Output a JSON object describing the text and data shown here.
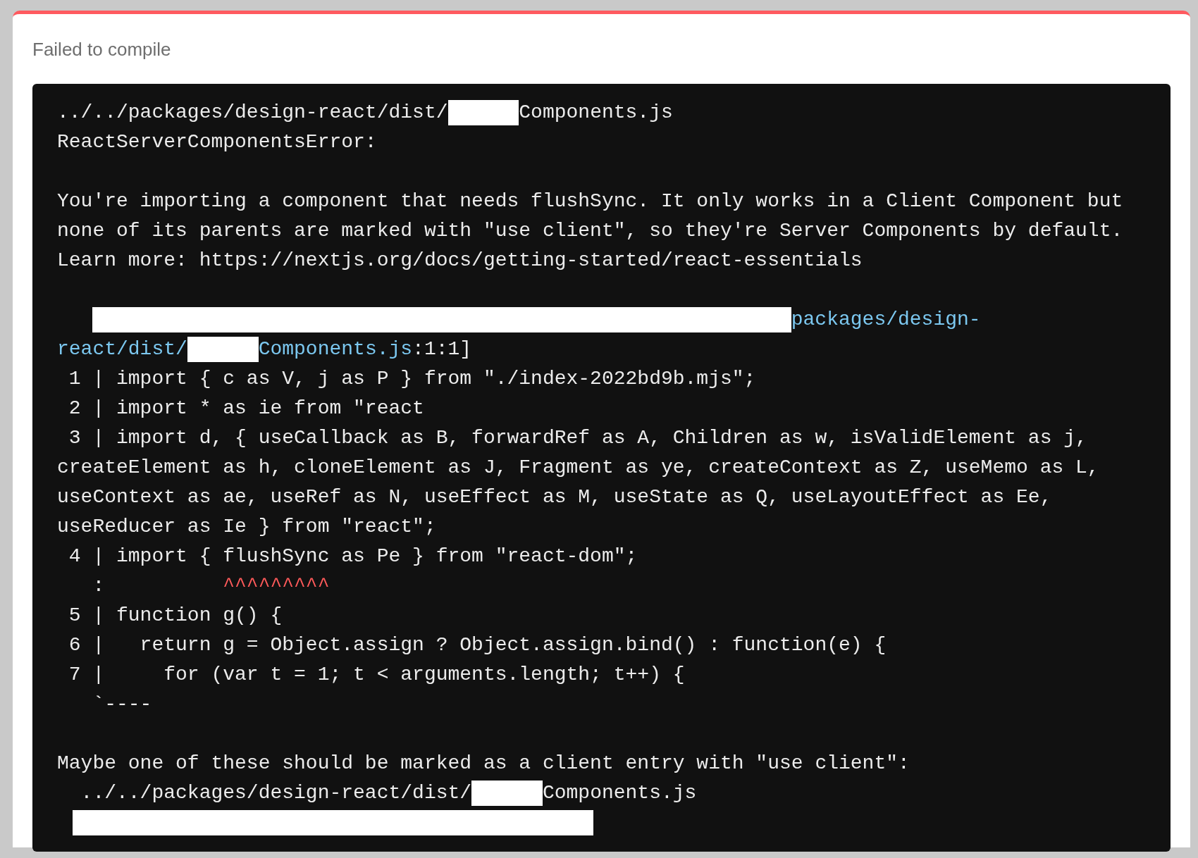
{
  "title": "Failed to compile",
  "lines": [
    {
      "kind": "code",
      "segments": [
        {
          "kind": "text",
          "text": "../../packages/design-react/dist/"
        },
        {
          "kind": "redacted_short"
        },
        {
          "kind": "text",
          "text": "Components.js"
        }
      ]
    },
    {
      "kind": "code",
      "segments": [
        {
          "kind": "text",
          "text": "ReactServerComponentsError:"
        }
      ]
    },
    {
      "kind": "blank"
    },
    {
      "kind": "code",
      "segments": [
        {
          "kind": "text",
          "text": "You're importing a component that needs flushSync. It only works in a Client Component but"
        }
      ]
    },
    {
      "kind": "code",
      "segments": [
        {
          "kind": "text",
          "text": "none of its parents are marked with \"use client\", so they're Server Components by default."
        }
      ]
    },
    {
      "kind": "code",
      "segments": [
        {
          "kind": "text",
          "text": "Learn more: https://nextjs.org/docs/getting-started/react-essentials"
        }
      ]
    },
    {
      "kind": "blank"
    },
    {
      "kind": "code",
      "segments": [
        {
          "kind": "redacted_wide"
        },
        {
          "kind": "link",
          "text": "packages/design-"
        }
      ]
    },
    {
      "kind": "code",
      "segments": [
        {
          "kind": "link",
          "text": "react/dist/"
        },
        {
          "kind": "redacted_short"
        },
        {
          "kind": "link",
          "text": "Components.js"
        },
        {
          "kind": "text",
          "text": ":1:1]"
        }
      ]
    },
    {
      "kind": "code",
      "segments": [
        {
          "kind": "text",
          "text": " 1 | import { c as V, j as P } from \"./index-2022bd9b.mjs\";"
        }
      ]
    },
    {
      "kind": "code",
      "segments": [
        {
          "kind": "text",
          "text": " 2 | import * as ie from \"react"
        }
      ]
    },
    {
      "kind": "code",
      "segments": [
        {
          "kind": "text",
          "text": " 3 | import d, { useCallback as B, forwardRef as A, Children as w, isValidElement as j,"
        }
      ]
    },
    {
      "kind": "code",
      "segments": [
        {
          "kind": "text",
          "text": "createElement as h, cloneElement as J, Fragment as ye, createContext as Z, useMemo as L,"
        }
      ]
    },
    {
      "kind": "code",
      "segments": [
        {
          "kind": "text",
          "text": "useContext as ae, useRef as N, useEffect as M, useState as Q, useLayoutEffect as Ee,"
        }
      ]
    },
    {
      "kind": "code",
      "segments": [
        {
          "kind": "text",
          "text": "useReducer as Ie } from \"react\";"
        }
      ]
    },
    {
      "kind": "code",
      "segments": [
        {
          "kind": "text",
          "text": " 4 | import { flushSync as Pe } from \"react-dom\";"
        }
      ]
    },
    {
      "kind": "code",
      "segments": [
        {
          "kind": "text",
          "text": "   :          "
        },
        {
          "kind": "marker",
          "text": "^^^^^^^^^"
        }
      ]
    },
    {
      "kind": "code",
      "segments": [
        {
          "kind": "text",
          "text": " 5 | function g() {"
        }
      ]
    },
    {
      "kind": "code",
      "segments": [
        {
          "kind": "text",
          "text": " 6 |   return g = Object.assign ? Object.assign.bind() : function(e) {"
        }
      ]
    },
    {
      "kind": "code",
      "segments": [
        {
          "kind": "text",
          "text": " 7 |     for (var t = 1; t < arguments.length; t++) {"
        }
      ]
    },
    {
      "kind": "code",
      "segments": [
        {
          "kind": "text",
          "text": "   `----"
        }
      ]
    },
    {
      "kind": "blank"
    },
    {
      "kind": "code",
      "segments": [
        {
          "kind": "text",
          "text": "Maybe one of these should be marked as a client entry with \"use client\":"
        }
      ]
    },
    {
      "kind": "code",
      "segments": [
        {
          "kind": "text",
          "text": "  ../../packages/design-react/dist/"
        },
        {
          "kind": "redacted_short"
        },
        {
          "kind": "text",
          "text": "Components.js"
        }
      ]
    },
    {
      "kind": "code",
      "segments": [
        {
          "kind": "redacted_medium"
        }
      ]
    }
  ]
}
